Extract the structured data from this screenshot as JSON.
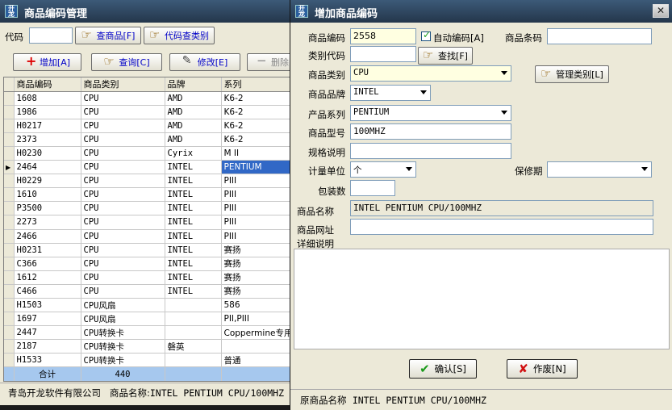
{
  "main": {
    "title": "商品编码管理",
    "app_icon_text": "开龙",
    "code_label": "代码",
    "code_value": "",
    "find_product_btn": "查商品[F]",
    "code_find_category_btn": "代码查类别",
    "add_btn": "增加[A]",
    "query_btn": "查询[C]",
    "modify_btn": "修改[E]",
    "delete_btn": "删除",
    "columns": [
      "商品编码",
      "商品类别",
      "品牌",
      "系列"
    ],
    "rows": [
      [
        "1608",
        "CPU",
        "AMD",
        "K6-2"
      ],
      [
        "1986",
        "CPU",
        "AMD",
        "K6-2"
      ],
      [
        "H0217",
        "CPU",
        "AMD",
        "K6-2"
      ],
      [
        "2373",
        "CPU",
        "AMD",
        "K6-2"
      ],
      [
        "H0230",
        "CPU",
        "Cyrix",
        "M II"
      ],
      [
        "2464",
        "CPU",
        "INTEL",
        "PENTIUM"
      ],
      [
        "H0229",
        "CPU",
        "INTEL",
        "PIII"
      ],
      [
        "1610",
        "CPU",
        "INTEL",
        "PIII"
      ],
      [
        "P3500",
        "CPU",
        "INTEL",
        "PIII"
      ],
      [
        "2273",
        "CPU",
        "INTEL",
        "PIII"
      ],
      [
        "2466",
        "CPU",
        "INTEL",
        "PIII"
      ],
      [
        "H0231",
        "CPU",
        "INTEL",
        "赛扬"
      ],
      [
        "C366",
        "CPU",
        "INTEL",
        "赛扬"
      ],
      [
        "1612",
        "CPU",
        "INTEL",
        "赛扬"
      ],
      [
        "C466",
        "CPU",
        "INTEL",
        "赛扬"
      ],
      [
        "H1503",
        "CPU风扇",
        "",
        "586"
      ],
      [
        "1697",
        "CPU风扇",
        "",
        "PII,PIII"
      ],
      [
        "2447",
        "CPU转换卡",
        "",
        "Coppermine专用"
      ],
      [
        "2187",
        "CPU转换卡",
        "磐英",
        ""
      ],
      [
        "H1533",
        "CPU转换卡",
        "",
        "普通"
      ]
    ],
    "total_label": "合计",
    "total_value": "440",
    "status_company": "青岛开龙软件有限公司",
    "status_name_label": "商品名称:",
    "status_name_value": "INTEL PENTIUM CPU/100MHZ"
  },
  "dialog": {
    "title": "增加商品编码",
    "code_label": "商品编码",
    "code_value": "2558",
    "auto_code_label": "自动编码[A]",
    "auto_code_checked": true,
    "barcode_label": "商品条码",
    "barcode_value": "",
    "category_code_label": "类别代码",
    "category_code_value": "",
    "find_btn": "查找[F]",
    "category_label": "商品类别",
    "category_value": "CPU",
    "manage_category_btn": "管理类别[L]",
    "brand_label": "商品品牌",
    "brand_value": "INTEL",
    "series_label": "产品系列",
    "series_value": "PENTIUM",
    "model_label": "商品型号",
    "model_value": "100MHZ",
    "spec_label": "规格说明",
    "spec_value": "",
    "unit_label": "计量单位",
    "unit_value": "个",
    "warranty_label": "保修期",
    "warranty_value": "",
    "package_label": "包装数",
    "package_value": "",
    "name_label": "商品名称",
    "name_value": "INTEL PENTIUM CPU/100MHZ",
    "url_label": "商品网址",
    "url_value": "",
    "detail_label": "详细说明",
    "ok_btn": "确认[S]",
    "cancel_btn": "作废[N]",
    "orig_name_label": "原商品名称",
    "orig_name_value": "INTEL PENTIUM CPU/100MHZ"
  }
}
